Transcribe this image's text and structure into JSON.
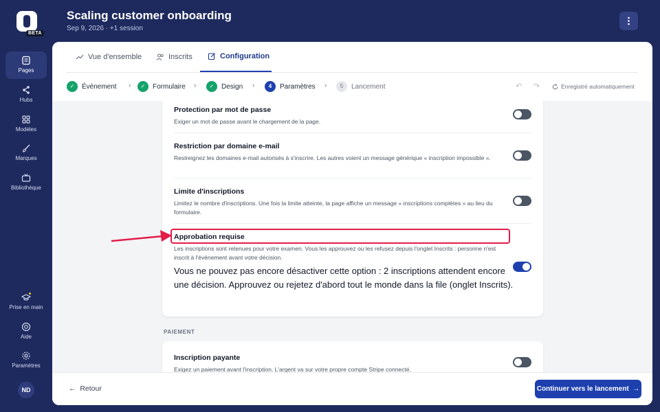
{
  "app": {
    "beta": "BETA",
    "title": "Scaling customer onboarding",
    "subtitle": "Sep 9, 2026 · +1 session"
  },
  "sidebar": {
    "items": [
      {
        "label": "Pages",
        "icon": "pages-icon",
        "active": true
      },
      {
        "label": "Hubs",
        "icon": "share-icon"
      },
      {
        "label": "Modèles",
        "icon": "grid-icon"
      },
      {
        "label": "Marques",
        "icon": "brush-icon"
      },
      {
        "label": "Bibliothèque",
        "icon": "tv-icon"
      }
    ],
    "bottom": [
      {
        "label": "Prise en main",
        "icon": "graduation-cap-icon"
      },
      {
        "label": "Aide",
        "icon": "help-icon"
      },
      {
        "label": "Paramètres",
        "icon": "gear-icon"
      }
    ],
    "avatar": "ND"
  },
  "tabs": [
    {
      "label": "Vue d'ensemble"
    },
    {
      "label": "Inscrits"
    },
    {
      "label": "Configuration",
      "active": true
    }
  ],
  "steps": [
    {
      "label": "Événement",
      "state": "done"
    },
    {
      "label": "Formulaire",
      "state": "done"
    },
    {
      "label": "Design",
      "state": "done"
    },
    {
      "label": "Paramètres",
      "number": "4",
      "state": "current"
    },
    {
      "label": "Lancement",
      "number": "5",
      "state": "todo"
    }
  ],
  "autosave": "Enregistré automatiquement",
  "settings": [
    {
      "title": "Protection par mot de passe",
      "desc": "Exiger un mot de passe avant le chargement de la page.",
      "on": false
    },
    {
      "title": "Restriction par domaine e-mail",
      "desc": "Restreignez les domaines e-mail autorisés à s'inscrire. Les autres voient un message générique « inscription impossible ».",
      "on": false
    },
    {
      "title": "Limite d'inscriptions",
      "desc": "Limitez le nombre d'inscriptions. Une fois la limite atteinte, la page affiche un message « inscriptions complètes » au lieu du formulaire.",
      "on": false
    },
    {
      "title": "Approbation requise",
      "desc": "Les inscriptions sont retenues pour votre examen. Vous les approuvez ou les refusez depuis l'onglet Inscrits : personne n'est inscrit à l'événement avant votre décision.",
      "on": true,
      "warning": "Vous ne pouvez pas encore désactiver cette option : 2 inscriptions attendent encore une décision. Approuvez ou rejetez d'abord tout le monde dans la file (onglet Inscrits)."
    }
  ],
  "payment": {
    "section": "PAIEMENT",
    "title": "Inscription payante",
    "desc": "Exigez un paiement avant l'inscription. L'argent va sur votre propre compte Stripe connecté.",
    "on": false
  },
  "footer": {
    "back": "Retour",
    "continue": "Continuer vers le lancement"
  },
  "colors": {
    "background": "#1e2a5e",
    "accent": "#1e40af",
    "success": "#15a36a",
    "highlight": "#e11d48"
  }
}
